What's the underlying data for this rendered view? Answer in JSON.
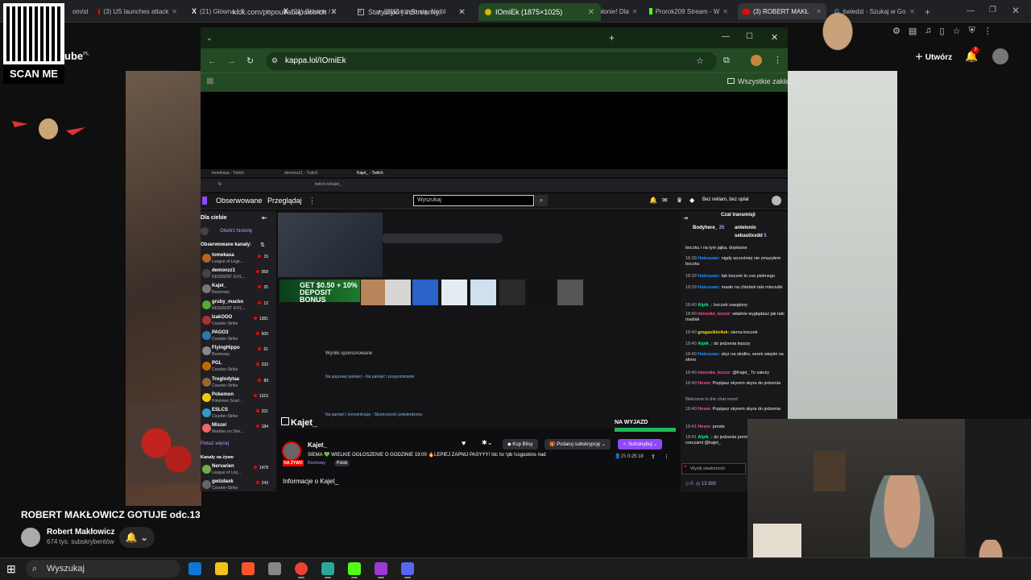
{
  "outer_tabs": [
    {
      "label": "om/st",
      "type": "generic",
      "active": false
    },
    {
      "label": "(3) US launches attack",
      "type": "youtube",
      "active": false
    },
    {
      "label": "(21) Główna / X",
      "type": "x",
      "active": false
    },
    {
      "label": "(21) Główna / X",
      "type": "x",
      "active": false
    },
    {
      "label": "(23)Zaczęło się. Najbl",
      "type": "tiktok",
      "active": false
    },
    {
      "label": "(3) Zaczęło Się! USA i",
      "type": "youtube",
      "active": false
    },
    {
      "label": "(3) Teheran płonie! Dla",
      "type": "youtube",
      "active": false
    },
    {
      "label": "Prorok209 Stream - W",
      "type": "kick",
      "active": false
    },
    {
      "label": "(3) ROBERT MAKŁ",
      "type": "youtube",
      "active": true
    },
    {
      "label": "świedzi - Szukaj w Go",
      "type": "google",
      "active": false
    }
  ],
  "youtube": {
    "logo_suffix": "ube",
    "logo_sup": "PL",
    "create_label": "Utwórz",
    "notif_count": "3",
    "video_title": "ROBERT MAKŁOWICZ GOTUJE odc.13 \"B",
    "channel_name": "Robert Makłowicz",
    "subscribers": "674 tys. subskrybentów"
  },
  "qr": {
    "caption": "SCAN ME"
  },
  "popup": {
    "tabs": [
      {
        "label": "kick.com/popout/ahapulco/ch",
        "active": false
      },
      {
        "label": "Statystyki | inStreamly",
        "active": false
      },
      {
        "label": "IOmiEk (1875×1025)",
        "active": true
      }
    ],
    "url": "kappa.lol/IOmiEk",
    "bookmarks_label": "Wszystkie zakładki"
  },
  "twitch": {
    "inner_tabs": [
      "tomekasa - Twitch",
      "demonzz1 - Twitch",
      "Kajet_ - Twitch"
    ],
    "inner_url": "twitch.tv/kajet_",
    "nav_following": "Obserwowane",
    "nav_browse": "Przeglądaj",
    "search_placeholder": "Wyszukaj",
    "ad_free": "Bez reklam, bez opłat",
    "for_you": "Dla ciebie",
    "open_history": "Otwórz historię",
    "followed_channels": "Obserwowane kanały:",
    "channels": [
      {
        "name": "tomekasa",
        "game": "League of Lege...",
        "viewers": "15"
      },
      {
        "name": "demonzz1",
        "game": "RESIDENT EVIL...",
        "viewers": "958"
      },
      {
        "name": "Kajet_",
        "game": "Rozmowy",
        "viewers": "25"
      },
      {
        "name": "gruby_macko",
        "game": "RESIDENT EVIL...",
        "viewers": "12"
      },
      {
        "name": "IzakOOO",
        "game": "Counter-Strike",
        "viewers": "1381"
      },
      {
        "name": "PAGO3",
        "game": "Counter-Strike",
        "viewers": "500"
      },
      {
        "name": "FlyingHippo",
        "game": "Rozmowy",
        "viewers": "61"
      },
      {
        "name": "PGL",
        "game": "Counter-Strike",
        "viewers": "332"
      },
      {
        "name": "Troglodytaa",
        "game": "Counter-Strike",
        "viewers": "89"
      },
      {
        "name": "Pokemon",
        "game": "Pokémon Scarl...",
        "viewers": "1315"
      },
      {
        "name": "ESLCS",
        "game": "Counter-Strike",
        "viewers": "331"
      },
      {
        "name": "Miszel",
        "game": "Marbles on Stre...",
        "viewers": "184"
      }
    ],
    "show_more": "Pokaż więcej",
    "live_channels": "Kanały na żywo",
    "live": [
      {
        "name": "Nervarien",
        "game": "League of Leg...",
        "viewers": "1478"
      },
      {
        "name": "gwizdaxk",
        "game": "Counter-Strike",
        "viewers": "243"
      }
    ],
    "bonus_text": "GET $0.50 + 10% DEPOSIT BONUS",
    "sponsored": "Wyniki sponsorowane",
    "result1": "Na poprawę pamięci - Na pamięć i przypominanie",
    "result2": "Na pamięć i koncentrację - Skuteczność potwierdzona",
    "stream_logo": "Kajet_",
    "na_wyjazd": "NA WYJAZD",
    "streamer": "Kajet_",
    "stream_title": "SIEMA 💚 WIELKIE OGŁOSZENIE O GODZINIE 19:00 🔥LEPIEJ ZAPNIJ PASYYY! !dc !sr !pb !csgoskins #ad",
    "live_badge": "NA ŻYWO",
    "category": "Rozmowy",
    "language": "Polski",
    "buy_bits": "Kup Bitsy",
    "gift_sub": "Podaruj subskrypcję",
    "subscribe": "Subskrybuj",
    "viewer_count": "25",
    "uptime": "0:25:18",
    "about": "Informacje o Kajet_",
    "chat_header": "Czat transmisji",
    "chat_top": [
      {
        "user": "Bodyhere_",
        "value": "25"
      },
      {
        "user": "antelonio",
        "value": ""
      },
      {
        "user": "sebastixxdd",
        "value": "5"
      }
    ],
    "chat": [
      {
        "time": "",
        "user": "",
        "text": "boczku i na tym jajka, dojebane"
      },
      {
        "time": "18:39",
        "user": "Hakusaan:",
        "text": "nigdy wcześniej nie zmazyłem boczku"
      },
      {
        "time": "18:39",
        "user": "Hakusaan:",
        "text": "tak boczek to cos pieknego"
      },
      {
        "time": "18:39",
        "user": "Hakusaan:",
        "text": "masło na chlebek taki mleciutki"
      },
      {
        "time": "18:40",
        "user": "Alpik_:",
        "text": "boczek zwegiony"
      },
      {
        "time": "18:40",
        "user": "mieszko_kocur:",
        "text": "właśnie wyglądasz jak taki maślak"
      },
      {
        "time": "18:40",
        "user": "gragasikto4uk:",
        "text": "siema boczek"
      },
      {
        "time": "18:40",
        "user": "Alpik_:",
        "text": "do jedzenia lepszy"
      },
      {
        "time": "18:40",
        "user": "Hakusaan:",
        "text": "skyr na słodko, serek wiejski na słono"
      },
      {
        "time": "18:40",
        "user": "mieszko_kocur:",
        "text": "@Kajet_ To zależy"
      },
      {
        "time": "18:40",
        "user": "Hesm:",
        "text": "Popijasz skyrem skyra do jedzenia"
      },
      {
        "time": "",
        "user": "",
        "text": "Welcome to the chat room!"
      },
      {
        "time": "18:40",
        "user": "Hesm:",
        "text": "Popijasz skyrem skyra do jedzenia"
      },
      {
        "time": "18:41",
        "user": "Hesm:",
        "text": "proste"
      },
      {
        "time": "18:41",
        "user": "Alpik_:",
        "text": "do jedzenia pomieszac z innymi rzeczami @kajet_"
      }
    ],
    "chat_placeholder": "Wyślij wiadomość",
    "points": "0",
    "points_total": "13 890"
  },
  "taskbar": {
    "search_label": "Wyszukaj",
    "apps": [
      "edge",
      "explorer",
      "brave",
      "app",
      "chrome",
      "app2",
      "kick",
      "app3",
      "discord"
    ]
  }
}
